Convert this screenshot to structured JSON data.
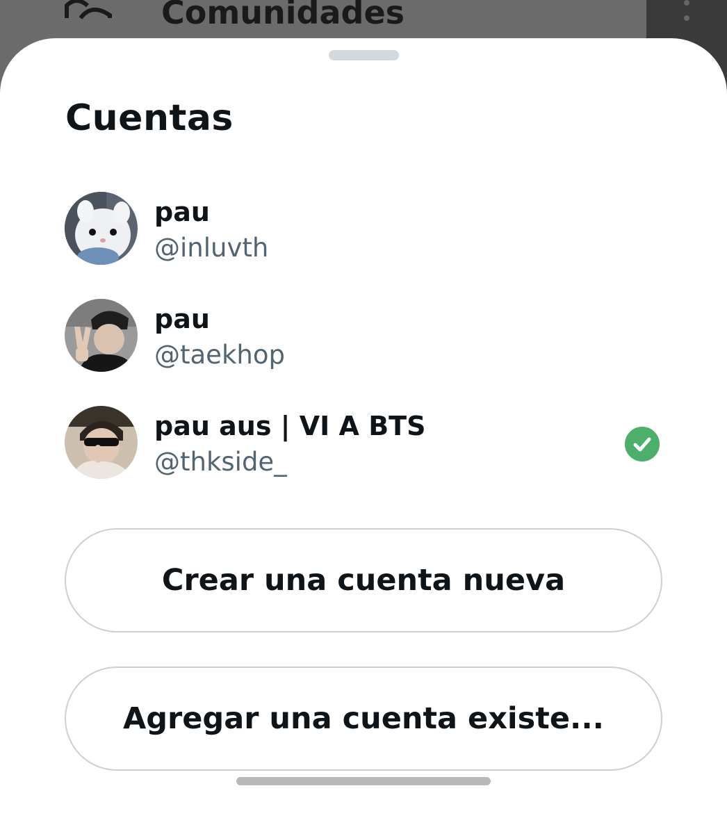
{
  "background": {
    "menu_label": "Comunidades",
    "menu_icon": "communities-icon"
  },
  "sheet": {
    "title": "Cuentas",
    "accounts": [
      {
        "name": "pau",
        "handle": "@inluvth",
        "avatar": "white-plush-avatar",
        "selected": false
      },
      {
        "name": "pau",
        "handle": "@taekhop",
        "avatar": "person-peace-sign-avatar",
        "selected": false
      },
      {
        "name": "pau aus | VI A BTS",
        "handle": "@thkside_",
        "avatar": "person-sunglasses-avatar",
        "selected": true
      }
    ],
    "selected_icon": "check-circle-icon",
    "selected_color": "#4caf6a",
    "create_label": "Crear una cuenta nueva",
    "add_existing_label": "Agregar una cuenta existe..."
  },
  "colors": {
    "text_primary": "#0f1419",
    "text_secondary": "#536471",
    "border": "#c7d1d8"
  }
}
